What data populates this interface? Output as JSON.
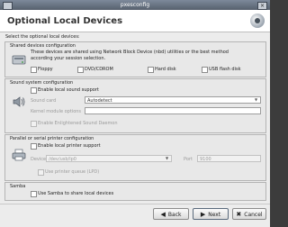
{
  "window": {
    "title": "pxesconfig",
    "close_glyph": "×"
  },
  "header": {
    "title": "Optional Local Devices",
    "logo_icon": "pxes-logo-icon"
  },
  "intro": "Select the optional local devices:",
  "shared": {
    "title": "Shared devices configuration",
    "icon": "drive-icon",
    "desc1": "These devices are shared using Network Block Device (nbd) utilities or the best method",
    "desc2": "according your session selection.",
    "items": [
      "Floppy",
      "DVD/CDROM",
      "Hard disk",
      "USB flash disk"
    ]
  },
  "sound": {
    "title": "Sound system configuration",
    "icon": "speaker-icon",
    "enable_label": "Enable local sound support",
    "driver_label": "Sound card",
    "driver_value": "Autodetect",
    "module_label": "Kernel module options",
    "module_value": "",
    "esd_label": "Enable Enlightened Sound Daemon"
  },
  "printer": {
    "title": "Parallel or serial printer configuration",
    "icon": "printer-icon",
    "enable_label": "Enable local printer support",
    "device_label": "Device",
    "device_value": "/dev/usb/lp0",
    "port_label": "Port",
    "port_value": "9100",
    "bidir_label": "Use printer queue (LPD)"
  },
  "samba": {
    "title": "Samba",
    "enable_label": "Use Samba to share local devices"
  },
  "buttons": {
    "back": "Back",
    "back_glyph": "◀",
    "next": "Next",
    "next_glyph": "▶",
    "cancel": "Cancel",
    "cancel_glyph": "✖"
  },
  "colors": {
    "titlebar": "#56606d",
    "background": "#ececec",
    "accent": "#2d4f86"
  }
}
